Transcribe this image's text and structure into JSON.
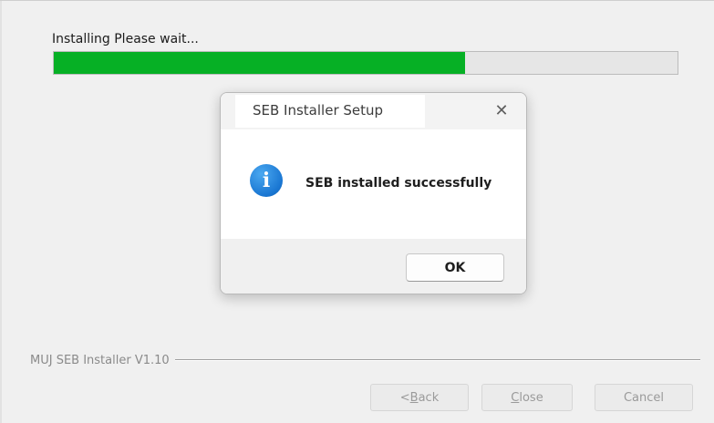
{
  "installer": {
    "status_text": "Installing Please wait...",
    "progress_fraction": 0.66,
    "progress_color": "#06b025",
    "version_label": "MUJ SEB Installer V1.10",
    "buttons": {
      "back": "< Back",
      "close": "Close",
      "cancel": "Cancel"
    }
  },
  "dialog": {
    "title": "SEB Installer Setup",
    "close_glyph": "✕",
    "icon": "info-icon",
    "icon_glyph": "i",
    "message": "SEB installed successfully",
    "ok_label": "OK"
  }
}
